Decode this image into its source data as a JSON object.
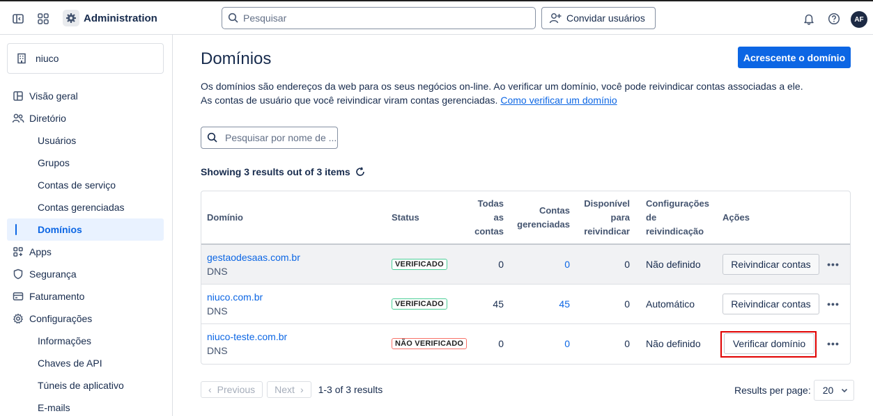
{
  "topbar": {
    "app_title": "Administration",
    "search_placeholder": "Pesquisar",
    "invite_label": "Convidar usuários",
    "avatar_initials": "AF"
  },
  "sidebar": {
    "org_name": "niuco",
    "items": [
      {
        "label": "Visão geral",
        "icon": "layout-icon"
      },
      {
        "label": "Diretório",
        "icon": "people-icon"
      },
      {
        "label": "Usuários"
      },
      {
        "label": "Grupos"
      },
      {
        "label": "Contas de serviço"
      },
      {
        "label": "Contas gerenciadas"
      },
      {
        "label": "Domínios",
        "active": true
      },
      {
        "label": "Apps",
        "icon": "apps-icon"
      },
      {
        "label": "Segurança",
        "icon": "shield-icon"
      },
      {
        "label": "Faturamento",
        "icon": "billing-icon"
      },
      {
        "label": "Configurações",
        "icon": "gear-icon"
      },
      {
        "label": "Informações"
      },
      {
        "label": "Chaves de API"
      },
      {
        "label": "Túneis de aplicativo"
      },
      {
        "label": "E-mails"
      }
    ]
  },
  "main": {
    "title": "Domínios",
    "add_button": "Acrescente o domínio",
    "description": "Os domínios são endereços da web para os seus negócios on-line. Ao verificar um domínio, você pode reivindicar contas associadas a ele. As contas de usuário que você reivindicar viram contas gerenciadas.",
    "description_link": "Como verificar um domínio",
    "table_search_placeholder": "Pesquisar por nome de ...",
    "results_text": "Showing 3 results out of 3 items"
  },
  "table": {
    "headers": {
      "domain": "Domínio",
      "status": "Status",
      "all_accounts_1": "Todas",
      "all_accounts_2": "as",
      "all_accounts_3": "contas",
      "managed_1": "Contas",
      "managed_2": "gerenciadas",
      "available_1": "Disponível",
      "available_2": "para",
      "available_3": "reivindicar",
      "config_1": "Configurações",
      "config_2": "de",
      "config_3": "reivindicação",
      "actions": "Ações"
    },
    "rows": [
      {
        "domain": "gestaodesaas.com.br",
        "method": "DNS",
        "status": "VERIFICADO",
        "all": "0",
        "managed": "0",
        "available": "0",
        "config": "Não definido",
        "action": "Reivindicar contas"
      },
      {
        "domain": "niuco.com.br",
        "method": "DNS",
        "status": "VERIFICADO",
        "all": "45",
        "managed": "45",
        "available": "0",
        "config": "Automático",
        "action": "Reivindicar contas"
      },
      {
        "domain": "niuco-teste.com.br",
        "method": "DNS",
        "status": "NÃO VERIFICADO",
        "all": "0",
        "managed": "0",
        "available": "0",
        "config": "Não definido",
        "action": "Verificar domínio"
      }
    ]
  },
  "pagination": {
    "previous": "Previous",
    "next": "Next",
    "info": "1-3 of 3 results",
    "per_page_label": "Results per page:",
    "per_page_value": "20"
  }
}
